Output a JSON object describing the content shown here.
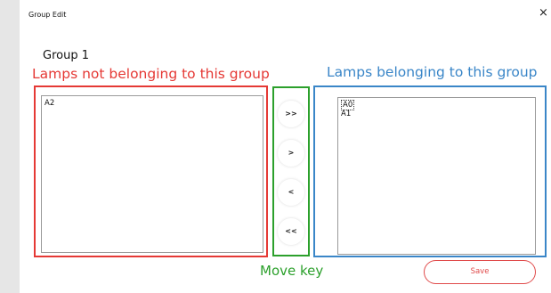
{
  "window": {
    "title": "Group Edit",
    "close_glyph": "×"
  },
  "group": {
    "name": "Group 1"
  },
  "annotations": {
    "not_belonging": "Lamps not belonging to this group",
    "belonging": "Lamps belonging to this group",
    "move_key": "Move key"
  },
  "lists": {
    "not_in_group": [
      "A2"
    ],
    "in_group": [
      "A0",
      "A1"
    ]
  },
  "move_buttons": {
    "move_all_right": ">>",
    "move_right": ">",
    "move_left": "<",
    "move_all_left": "<<"
  },
  "actions": {
    "save": "Save"
  },
  "colors": {
    "annotation_red": "#e53935",
    "annotation_blue": "#3a86c8",
    "annotation_green": "#2ca02c",
    "save_border": "#e04a4a"
  }
}
